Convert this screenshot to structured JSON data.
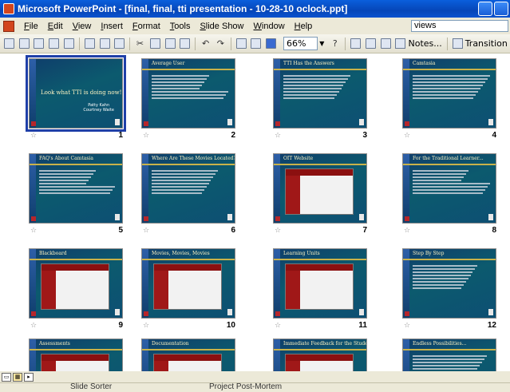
{
  "window": {
    "title": "Microsoft PowerPoint - [final, final, tti presentation - 10-28-10 oclock.ppt]"
  },
  "menu": {
    "items": [
      "File",
      "Edit",
      "View",
      "Insert",
      "Format",
      "Tools",
      "Slide Show",
      "Window",
      "Help"
    ],
    "help_box_value": "views"
  },
  "toolbar": {
    "zoom": "66%",
    "notes_label": "Notes...",
    "transition_label": "Transition"
  },
  "slides": [
    {
      "number": "1",
      "title": "",
      "headline": "Look what TTI is doing now!",
      "authors": "Patty Kahn\nCourtney Waite"
    },
    {
      "number": "2",
      "title": "Average User"
    },
    {
      "number": "3",
      "title": "TTI Has the Answers"
    },
    {
      "number": "4",
      "title": "Camtasia"
    },
    {
      "number": "5",
      "title": "FAQ's About Camtasia"
    },
    {
      "number": "6",
      "title": "Where Are These Movies Located?"
    },
    {
      "number": "7",
      "title": "OIT Website"
    },
    {
      "number": "8",
      "title": "For the Traditional Learner..."
    },
    {
      "number": "9",
      "title": "Blackboard"
    },
    {
      "number": "10",
      "title": "Movies, Movies, Movies"
    },
    {
      "number": "11",
      "title": "Learning Units"
    },
    {
      "number": "12",
      "title": "Step By Step"
    },
    {
      "number": "",
      "title": "Assessments"
    },
    {
      "number": "",
      "title": "Documentation"
    },
    {
      "number": "",
      "title": "Immediate Feedback for the Student"
    },
    {
      "number": "",
      "title": "Endless Possibilities..."
    }
  ],
  "status": {
    "view": "Slide Sorter",
    "template": "Project Post-Mortem"
  },
  "colors": {
    "titlebar": "#0646b8",
    "slide_bg": "#0c5a6e",
    "selection": "#1f3fa8"
  }
}
